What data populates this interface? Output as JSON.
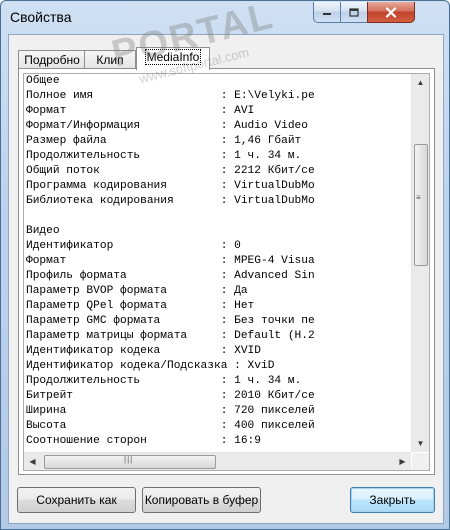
{
  "window": {
    "title": "Свойства"
  },
  "tabs": [
    {
      "label": "Подробно",
      "active": false
    },
    {
      "label": "Клип",
      "active": false
    },
    {
      "label": "MediaInfo",
      "active": true
    }
  ],
  "info_lines": [
    "Общее",
    "Полное имя                   : E:\\Velyki.pe",
    "Формат                       : AVI",
    "Формат/Информация            : Audio Video",
    "Размер файла                 : 1,46 Гбайт",
    "Продолжительность            : 1 ч. 34 м.",
    "Общий поток                  : 2212 Кбит/се",
    "Программа кодирования        : VirtualDubMo",
    "Библиотека кодирования       : VirtualDubMo",
    "",
    "Видео",
    "Идентификатор                : 0",
    "Формат                       : MPEG-4 Visua",
    "Профиль формата              : Advanced Sin",
    "Параметр BVOP формата        : Да",
    "Параметр QPel формата        : Нет",
    "Параметр GMC формата         : Без точки пе",
    "Параметр матрицы формата     : Default (H.2",
    "Идентификатор кодека         : XVID",
    "Идентификатор кодека/Подсказка : XviD",
    "Продолжительность            : 1 ч. 34 м.",
    "Битрейт                      : 2010 Кбит/се",
    "Ширина                       : 720 пикселей",
    "Высота                       : 400 пикселей",
    "Соотношение сторон           : 16:9"
  ],
  "buttons": {
    "save": "Сохранить как",
    "copy": "Копировать в буфер",
    "close": "Закрыть"
  },
  "watermark": {
    "brand": "PORTAL",
    "site": "www.softportal.com",
    "tm": "TM"
  },
  "icons": {
    "minimize": "minimize-icon",
    "maximize": "maximize-icon",
    "close": "close-icon"
  }
}
